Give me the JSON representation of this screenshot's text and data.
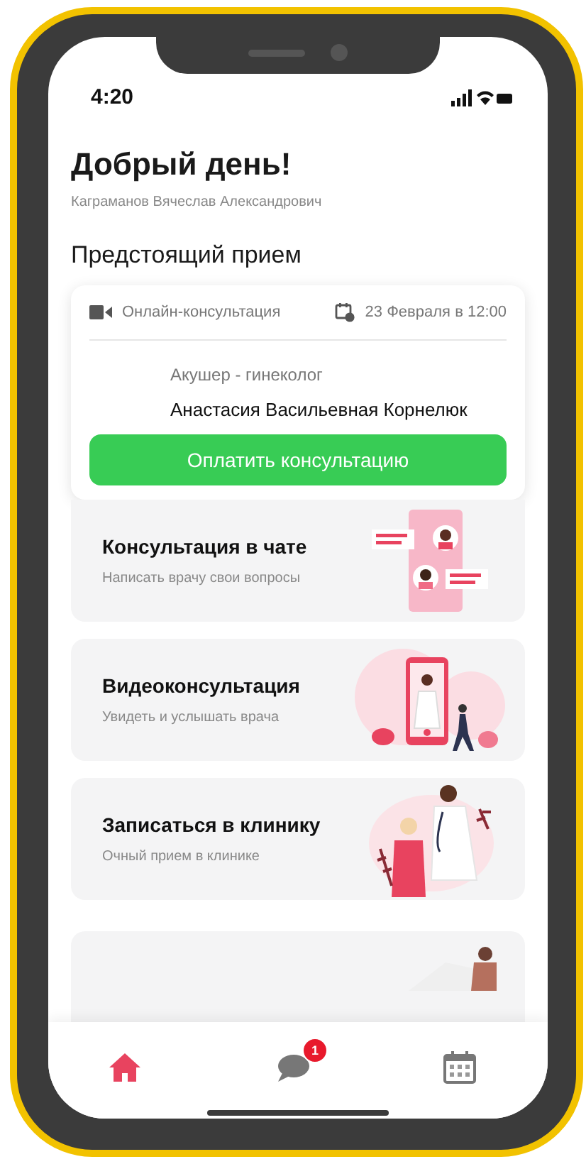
{
  "status_bar": {
    "time": "4:20"
  },
  "greeting": "Добрый день!",
  "user_name": "Каграманов Вячеслав Александрович",
  "section_title": "Предстоящий прием",
  "appointment": {
    "type": "Онлайн-консультация",
    "datetime": "23 Февраля в 12:00",
    "specialty": "Акушер - гинеколог",
    "doctor": "Анастасия Васильевная Корнелюк",
    "pay_button": "Оплатить консультацию"
  },
  "services": [
    {
      "kind": "chat",
      "title": "Консультация в чате",
      "subtitle": "Написать врачу свои вопросы"
    },
    {
      "kind": "video",
      "title": "Видеоконсультация",
      "subtitle": "Увидеть и услышать врача"
    },
    {
      "kind": "clinic",
      "title": "Записаться в клинику",
      "subtitle": "Очный прием в клинике"
    },
    {
      "kind": "reading"
    }
  ],
  "nav": [
    {
      "kind": "home",
      "selected": true
    },
    {
      "kind": "chat",
      "selected": false,
      "badge": "1"
    },
    {
      "kind": "calendar",
      "selected": false
    }
  ]
}
